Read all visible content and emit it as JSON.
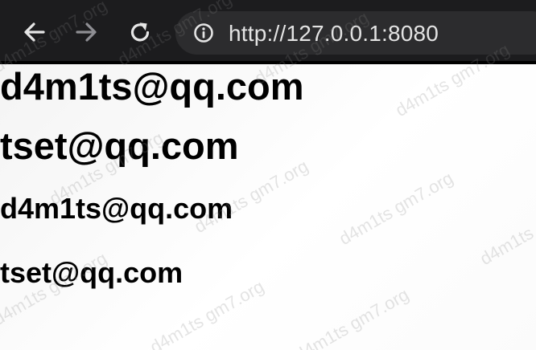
{
  "browser": {
    "url": "http://127.0.0.1:8080"
  },
  "page": {
    "headings": [
      "d4m1ts@qq.com",
      "tset@qq.com",
      "d4m1ts@qq.com",
      "tset@qq.com"
    ]
  },
  "watermark": {
    "text": "d4m1ts gm7.org"
  },
  "icons": {
    "back": "arrow-left-icon",
    "forward": "arrow-right-icon",
    "reload": "reload-icon",
    "info": "info-icon"
  },
  "colors": {
    "toolbar": "#1c1c1e",
    "address_bar": "#2c2c2e",
    "url_text": "#e3e3e3",
    "forward_disabled": "#8e8e93"
  }
}
